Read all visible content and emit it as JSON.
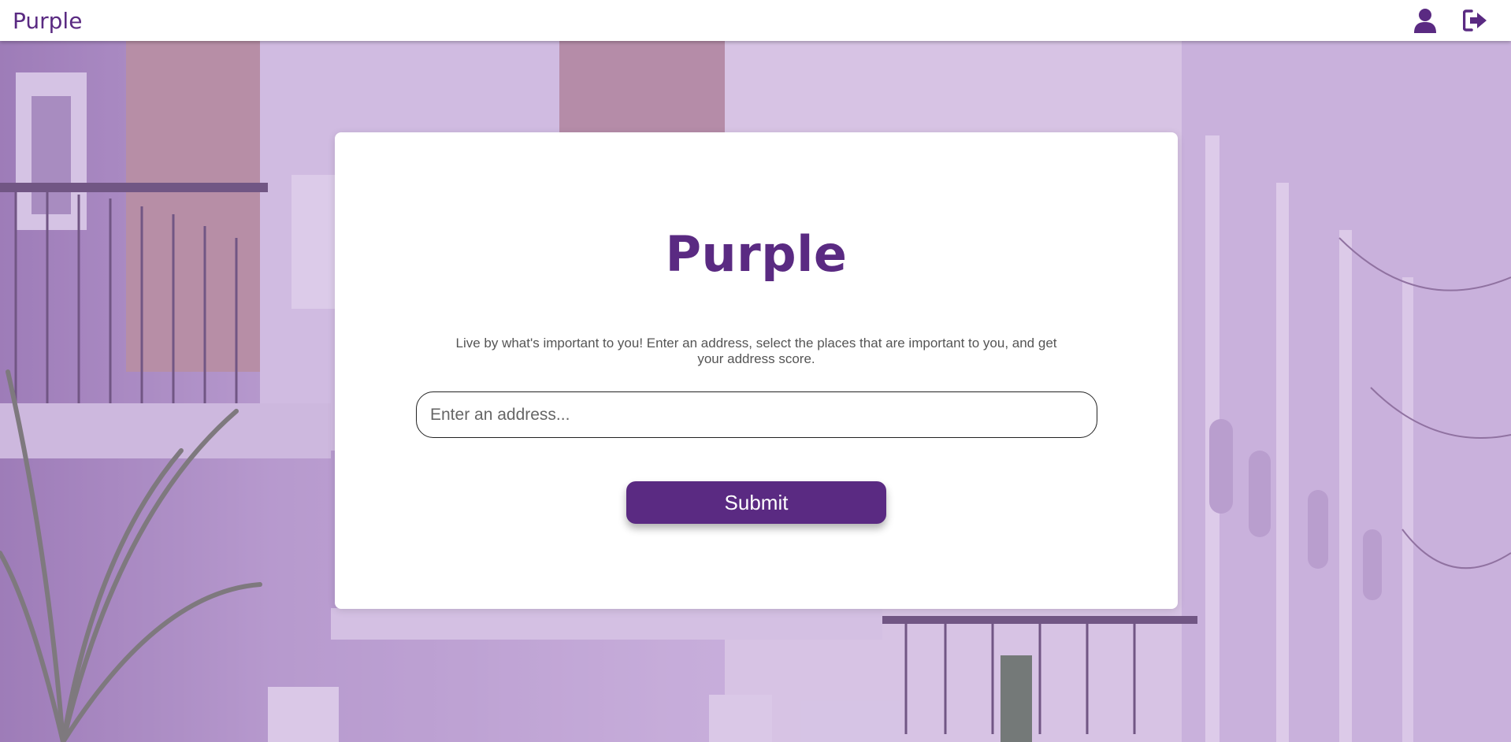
{
  "navbar": {
    "brand": "Purple",
    "icons": [
      "user-icon",
      "sign-out-icon"
    ]
  },
  "card": {
    "title": "Purple",
    "tagline": "Live by what's important to you! Enter an address, select the places that are important to you, and get your address score.",
    "address_placeholder": "Enter an address...",
    "address_value": "",
    "submit_label": "Submit"
  },
  "colors": {
    "brand": "#5a2a82",
    "card_background": "#ffffff",
    "hero_tint": "#c9b6d8"
  }
}
